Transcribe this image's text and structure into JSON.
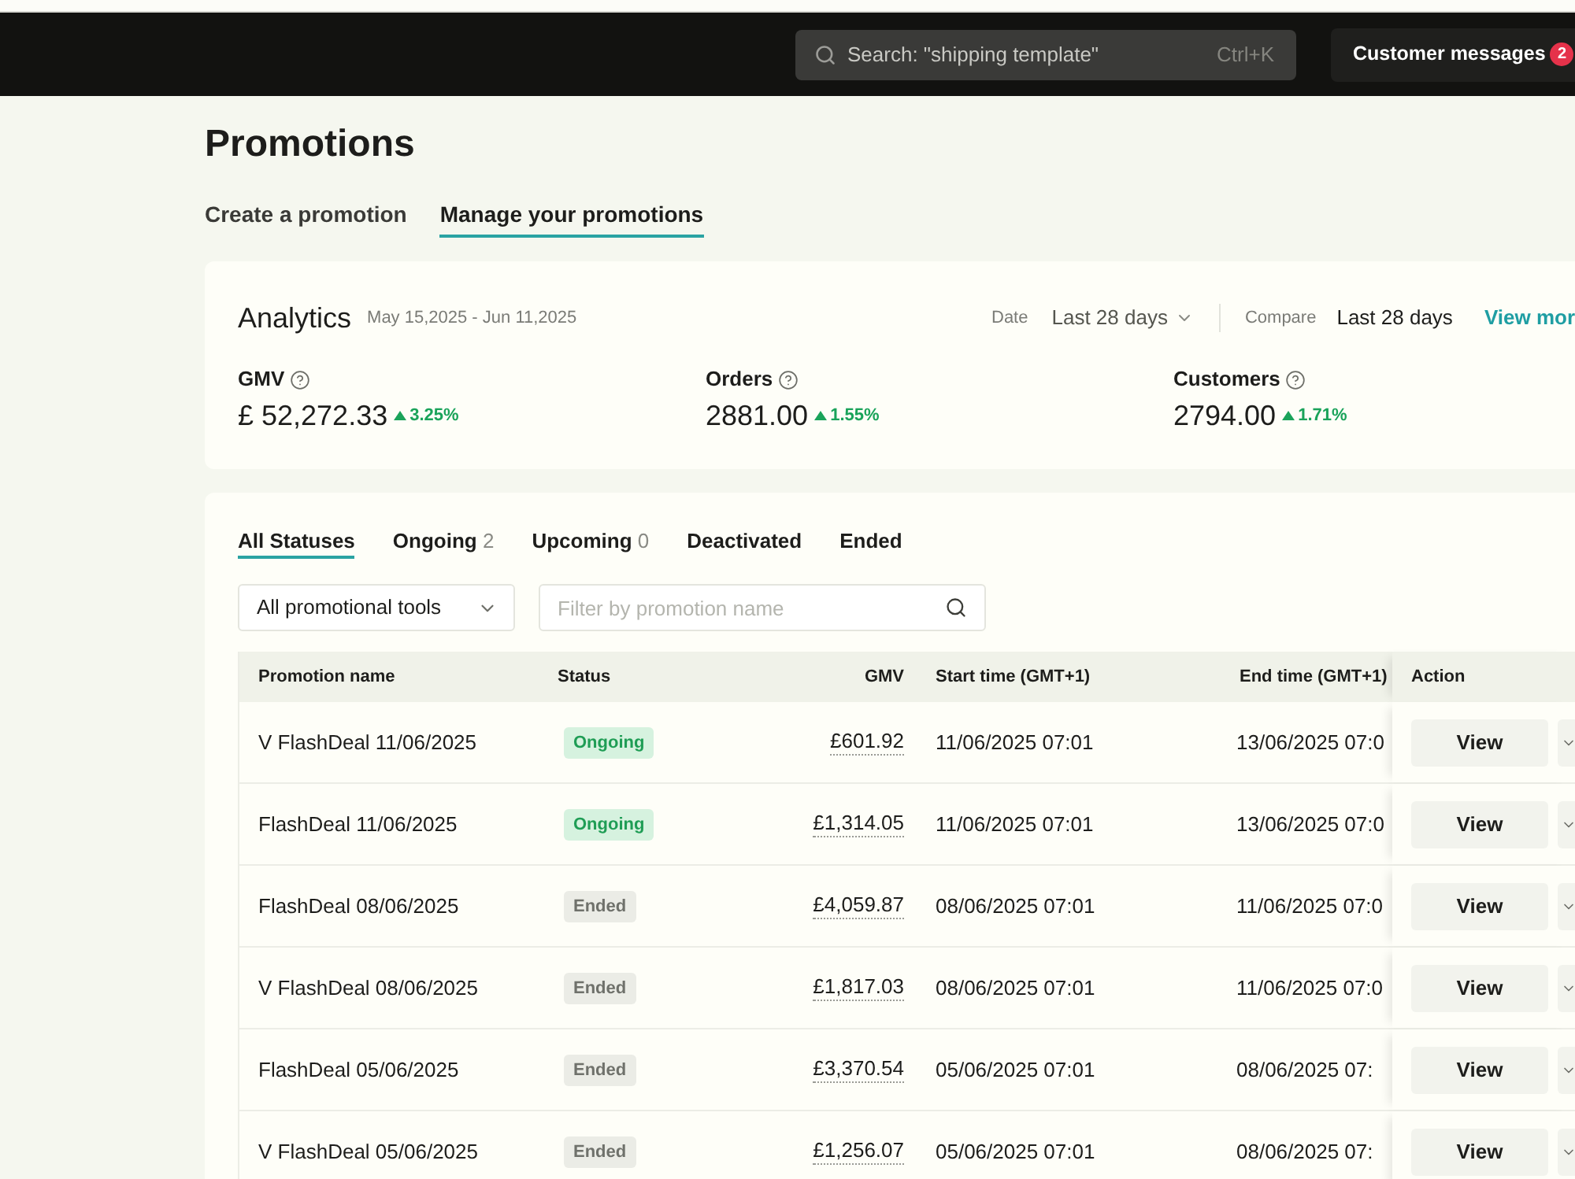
{
  "header": {
    "search": {
      "placeholder": "Search: \"shipping template\"",
      "shortcut": "Ctrl+K"
    },
    "messages": {
      "label": "Customer messages",
      "badge": "2"
    }
  },
  "page": {
    "title": "Promotions",
    "tabs": [
      {
        "label": "Create a promotion",
        "selected": false
      },
      {
        "label": "Manage your promotions",
        "selected": true
      }
    ]
  },
  "analytics": {
    "title": "Analytics",
    "date_range": "May 15,2025 - Jun 11,2025",
    "date_label": "Date",
    "date_value": "Last 28 days",
    "compare_label": "Compare",
    "compare_value": "Last 28 days",
    "link": "View mor",
    "metrics": [
      {
        "label": "GMV",
        "value": "£ 52,272.33",
        "change": "3.25%"
      },
      {
        "label": "Orders",
        "value": "2881.00",
        "change": "1.55%"
      },
      {
        "label": "Customers",
        "value": "2794.00",
        "change": "1.71%"
      }
    ]
  },
  "promotions": {
    "status_tabs": [
      {
        "label": "All Statuses",
        "selected": true
      },
      {
        "label": "Ongoing",
        "count": "2",
        "selected": false
      },
      {
        "label": "Upcoming",
        "count": "0",
        "selected": false
      },
      {
        "label": "Deactivated",
        "selected": false
      },
      {
        "label": "Ended",
        "selected": false
      }
    ],
    "tool_filter": {
      "value": "All promotional tools"
    },
    "name_filter": {
      "placeholder": "Filter by promotion name"
    },
    "table": {
      "columns": [
        "Promotion name",
        "Status",
        "GMV",
        "Start time (GMT+1)",
        "End time (GMT+1)",
        "Action"
      ],
      "rows": [
        {
          "name": "V FlashDeal 11/06/2025",
          "status": {
            "label": "Ongoing",
            "kind": "ongoing"
          },
          "gmv": "£601.92",
          "start": "11/06/2025 07:01",
          "end": "13/06/2025 07:0",
          "action": "View"
        },
        {
          "name": "FlashDeal 11/06/2025",
          "status": {
            "label": "Ongoing",
            "kind": "ongoing"
          },
          "gmv": "£1,314.05",
          "start": "11/06/2025 07:01",
          "end": "13/06/2025 07:0",
          "action": "View"
        },
        {
          "name": "FlashDeal 08/06/2025",
          "status": {
            "label": "Ended",
            "kind": "ended"
          },
          "gmv": "£4,059.87",
          "start": "08/06/2025 07:01",
          "end": "11/06/2025 07:0",
          "action": "View"
        },
        {
          "name": "V FlashDeal 08/06/2025",
          "status": {
            "label": "Ended",
            "kind": "ended"
          },
          "gmv": "£1,817.03",
          "start": "08/06/2025 07:01",
          "end": "11/06/2025 07:0",
          "action": "View"
        },
        {
          "name": "FlashDeal 05/06/2025",
          "status": {
            "label": "Ended",
            "kind": "ended"
          },
          "gmv": "£3,370.54",
          "start": "05/06/2025 07:01",
          "end": "08/06/2025 07:",
          "action": "View"
        },
        {
          "name": "V FlashDeal 05/06/2025",
          "status": {
            "label": "Ended",
            "kind": "ended"
          },
          "gmv": "£1,256.07",
          "start": "05/06/2025 07:01",
          "end": "08/06/2025 07:",
          "action": "View"
        }
      ]
    }
  }
}
